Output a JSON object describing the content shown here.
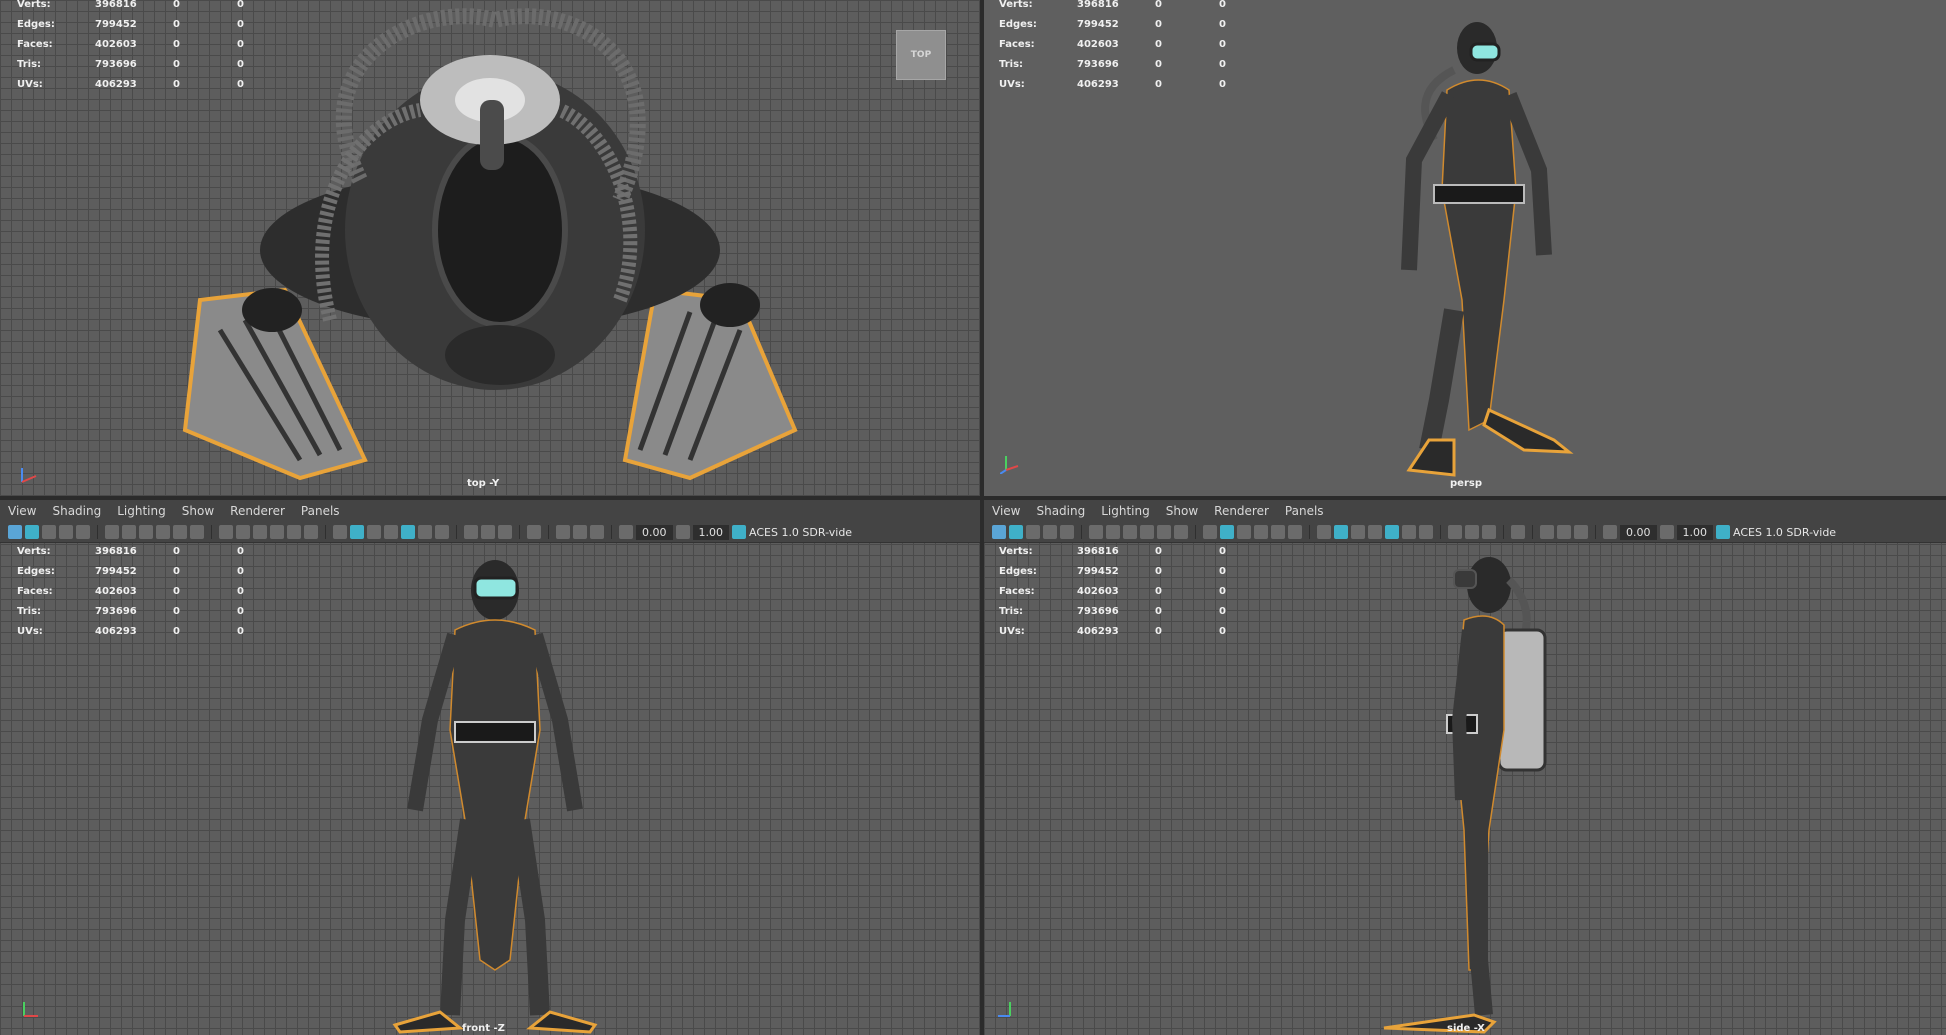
{
  "stats": {
    "labels": [
      "Verts:",
      "Edges:",
      "Faces:",
      "Tris:",
      "UVs:"
    ],
    "rows": [
      {
        "label": "Verts:",
        "value": "396816",
        "c1": "0",
        "c2": "0"
      },
      {
        "label": "Edges:",
        "value": "799452",
        "c1": "0",
        "c2": "0"
      },
      {
        "label": "Faces:",
        "value": "402603",
        "c1": "0",
        "c2": "0"
      },
      {
        "label": "Tris:",
        "value": "793696",
        "c1": "0",
        "c2": "0"
      },
      {
        "label": "UVs:",
        "value": "406293",
        "c1": "0",
        "c2": "0"
      }
    ]
  },
  "menu": {
    "view": "View",
    "shading": "Shading",
    "lighting": "Lighting",
    "show": "Show",
    "renderer": "Renderer",
    "panels": "Panels"
  },
  "toolbar": {
    "exposure": "0.00",
    "gamma": "1.00",
    "color_space": "ACES 1.0 SDR-vide"
  },
  "viewports": {
    "top": {
      "camera": "top -Y",
      "cube_label": "TOP"
    },
    "persp": {
      "camera": "persp"
    },
    "front": {
      "camera": "front -Z"
    },
    "side": {
      "camera": "side -X"
    }
  },
  "colors": {
    "grid_bg": "#5d5d5d",
    "persp_bg": "#5f5f5f",
    "selection": "#e8a33a",
    "mask_lens": "#8fe6e0"
  }
}
